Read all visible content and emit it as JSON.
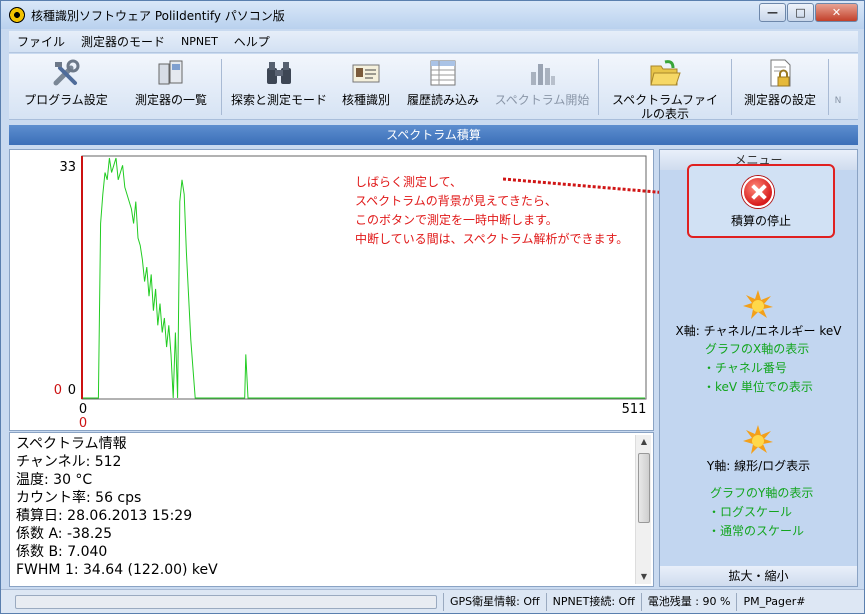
{
  "window": {
    "title": "核種識別ソフトウェア PoliIdentify パソコン版"
  },
  "menu": [
    "ファイル",
    "測定器のモード",
    "NPNET",
    "ヘルプ"
  ],
  "toolbar": {
    "program_settings": "プログラム設定",
    "device_list": "測定器の一覧",
    "search_measure": "探索と測定モード",
    "nuclide_id": "核種識別",
    "history_load": "履歴読み込み",
    "spectrum_start": "スペクトラム開始",
    "spectrum_file_1": "スペクトラムファイ",
    "spectrum_file_2": "ルの表示",
    "device_settings": "測定器の設定",
    "overflow": "N"
  },
  "spectrum_header": "スペクトラム積算",
  "chart": {
    "y_max_label": "33",
    "y_min_label_a": "0",
    "y_min_label_b": "0",
    "x_min_label": "0",
    "x_max_label": "511",
    "x_marker_label": "0"
  },
  "chart_data": {
    "type": "line",
    "x": [
      0,
      2,
      4,
      6,
      8,
      10,
      12,
      14,
      16,
      18,
      20,
      22,
      24,
      26,
      28,
      30,
      32,
      34,
      36,
      38,
      40,
      42,
      44,
      46,
      48,
      50,
      52,
      54,
      56,
      58,
      60,
      62,
      64,
      66,
      68,
      70,
      72,
      74,
      76,
      78,
      80,
      82,
      84,
      86,
      88,
      90,
      92,
      94,
      96,
      98,
      100,
      102,
      104,
      106,
      108,
      110,
      112,
      114,
      116,
      118,
      120,
      122,
      124,
      126,
      128,
      130,
      140,
      145,
      146,
      147,
      148,
      150,
      200,
      511
    ],
    "values": [
      0,
      0,
      0,
      0,
      0,
      0,
      0,
      0,
      24,
      28,
      31,
      30,
      33,
      31,
      32,
      33,
      30,
      31,
      32,
      29,
      28,
      27,
      26,
      24,
      27,
      22,
      21,
      19,
      16,
      18,
      14,
      17,
      12,
      15,
      10,
      13,
      9,
      11,
      7,
      10,
      6,
      0,
      9,
      0,
      27,
      30,
      28,
      20,
      14,
      8,
      4,
      0,
      0,
      0,
      0,
      0,
      0,
      0,
      0,
      0,
      0,
      0,
      0,
      0,
      0,
      0,
      0,
      0,
      0,
      0,
      6,
      0,
      0,
      0
    ],
    "xlim": [
      0,
      511
    ],
    "ylim": [
      0,
      33
    ],
    "grid": false,
    "color": "#22cc22"
  },
  "annotation": {
    "line1": "しばらく測定して、",
    "line2": "スペクトラムの背景が見えてきたら、",
    "line3": "このボタンで測定を一時中断します。",
    "line4": "中断している間は、スペクトラム解析ができます。"
  },
  "info": {
    "title": "スペクトラム情報",
    "channels": "チャンネル: 512",
    "temperature": "温度: 30 °C",
    "count_rate": "カウント率: 56 cps",
    "date": "積算日: 28.06.2013 15:29",
    "coef_a": "係数 A: -38.25",
    "coef_b": "係数 B: 7.040",
    "fwhm": "FWHM 1: 34.64 (122.00) keV"
  },
  "side": {
    "header": "メニュー",
    "stop_label": "積算の停止",
    "x_axis_title": "X軸: チャネル/エネルギー keV",
    "x_axis_desc": "グラフのX軸の表示",
    "x_axis_opt1": "・チャネル番号",
    "x_axis_opt2": "・keV 単位での表示",
    "y_axis_title": "Y軸: 線形/ログ表示",
    "y_axis_desc": "グラフのY軸の表示",
    "y_axis_opt1": "・ログスケール",
    "y_axis_opt2": "・通常のスケール",
    "footer": "拡大・縮小"
  },
  "status": {
    "gps": "GPS衛星情報: Off",
    "npnet": "NPNET接続: Off",
    "battery": "電池残量 : 90 %",
    "pager": "PM_Pager#"
  }
}
